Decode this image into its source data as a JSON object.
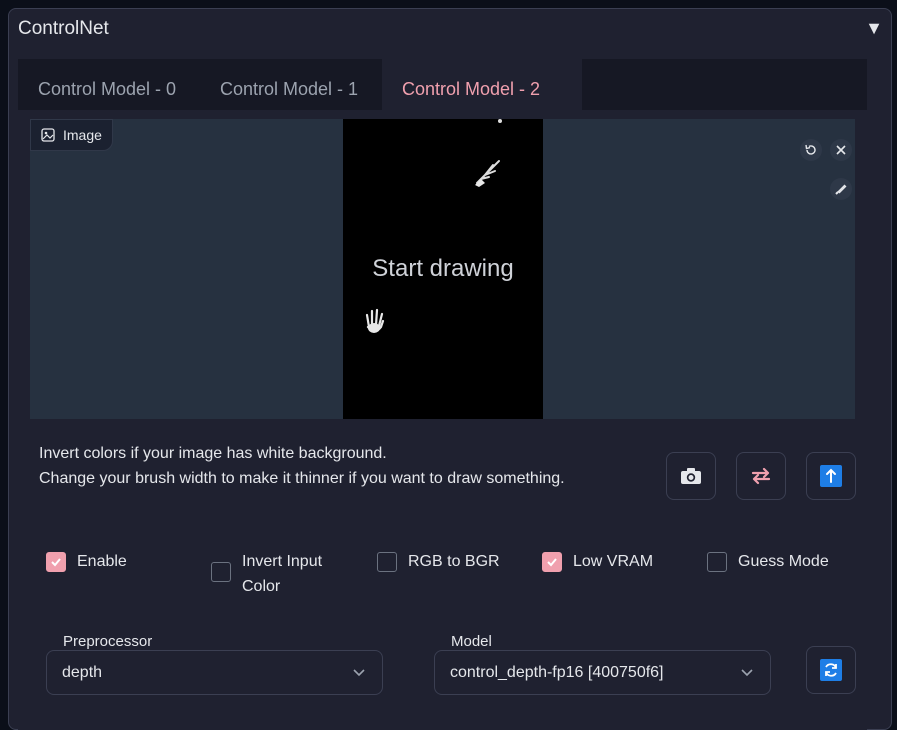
{
  "header": {
    "title": "ControlNet",
    "collapse_glyph": "▼"
  },
  "tabs": [
    {
      "label": "Control Model - 0",
      "active": false
    },
    {
      "label": "Control Model - 1",
      "active": false
    },
    {
      "label": "Control Model - 2",
      "active": true
    }
  ],
  "canvas": {
    "image_label": "Image",
    "placeholder": "Start drawing",
    "tools": [
      "undo-icon",
      "close-icon",
      "brush-icon"
    ]
  },
  "info": {
    "line1": "Invert colors if your image has white background.",
    "line2": "Change your brush width to make it thinner if you want to draw something."
  },
  "action_buttons": [
    "camera-icon",
    "swap-arrows-icon",
    "send-up-icon"
  ],
  "options": [
    {
      "label": "Enable",
      "checked": true
    },
    {
      "label": "Invert Input Color",
      "checked": false
    },
    {
      "label": "RGB to BGR",
      "checked": false
    },
    {
      "label": "Low VRAM",
      "checked": true
    },
    {
      "label": "Guess Mode",
      "checked": false
    }
  ],
  "preprocessor": {
    "label": "Preprocessor",
    "value": "depth"
  },
  "model": {
    "label": "Model",
    "value": "control_depth-fp16 [400750f6]"
  },
  "colors": {
    "accent": "#f0a0ae",
    "blue_button": "#1e7ee6",
    "panel": "#1f2130",
    "canvas_bg": "#263140"
  }
}
